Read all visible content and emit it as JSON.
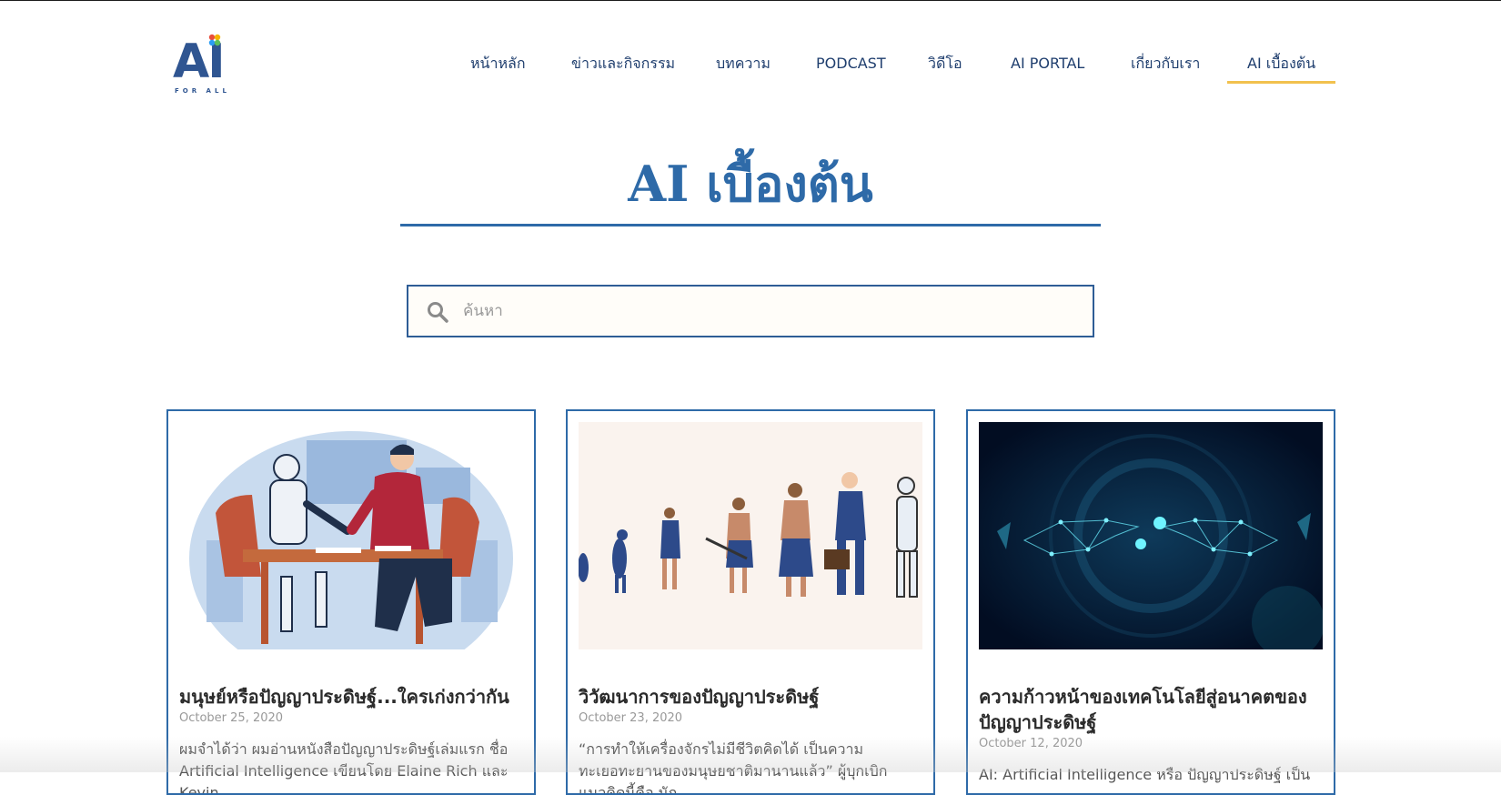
{
  "brand": {
    "logo_text": "AI",
    "logo_subtext": "FOR ALL"
  },
  "nav": {
    "items": [
      {
        "label": "หน้าหลัก"
      },
      {
        "label": "ข่าวและกิจกรรม"
      },
      {
        "label": "บทความ"
      },
      {
        "label": "PODCAST"
      },
      {
        "label": "วิดีโอ"
      },
      {
        "label": "AI PORTAL"
      },
      {
        "label": "เกี่ยวกับเรา"
      },
      {
        "label": "AI เบื้องต้น"
      }
    ],
    "active_index": 7
  },
  "page": {
    "title": "AI เบื้องต้น"
  },
  "search": {
    "placeholder": "ค้นหา",
    "value": ""
  },
  "cards": [
    {
      "image_icon": "robot-human-armwrestling-illustration",
      "title": "มนุษย์หรือปัญญาประดิษฐ์...ใครเก่งกว่ากัน",
      "date": "October 25, 2020",
      "excerpt": "ผมจำได้ว่า ผมอ่านหนังสือปัญญาประดิษฐ์เล่มแรก ชื่อ Artificial Intelligence เขียนโดย Elaine Rich และ Kevin"
    },
    {
      "image_icon": "human-evolution-to-robot-illustration",
      "title": "วิวัฒนาการของปัญญาประดิษฐ์",
      "date": "October 23, 2020",
      "excerpt": "“การทำให้เครื่องจักรไม่มีชีวิตคิดได้ เป็นความทะเยอทะยานของมนุษยชาติมานานแล้ว” ผู้บุกเบิกแนวคิดนี้คือ นัก"
    },
    {
      "image_icon": "digital-hands-technology-illustration",
      "title": "ความก้าวหน้าของเทคโนโลยีสู่อนาคตของปัญญาประดิษฐ์",
      "date": "October 12, 2020",
      "excerpt": "AI: Artificial Intelligence หรือ ปัญญาประดิษฐ์ เป็น"
    }
  ],
  "colors": {
    "primary": "#2e6aa8",
    "nav_text": "#1f3e6e",
    "active_underline": "#f2c14e",
    "logo": "#2f5591"
  }
}
